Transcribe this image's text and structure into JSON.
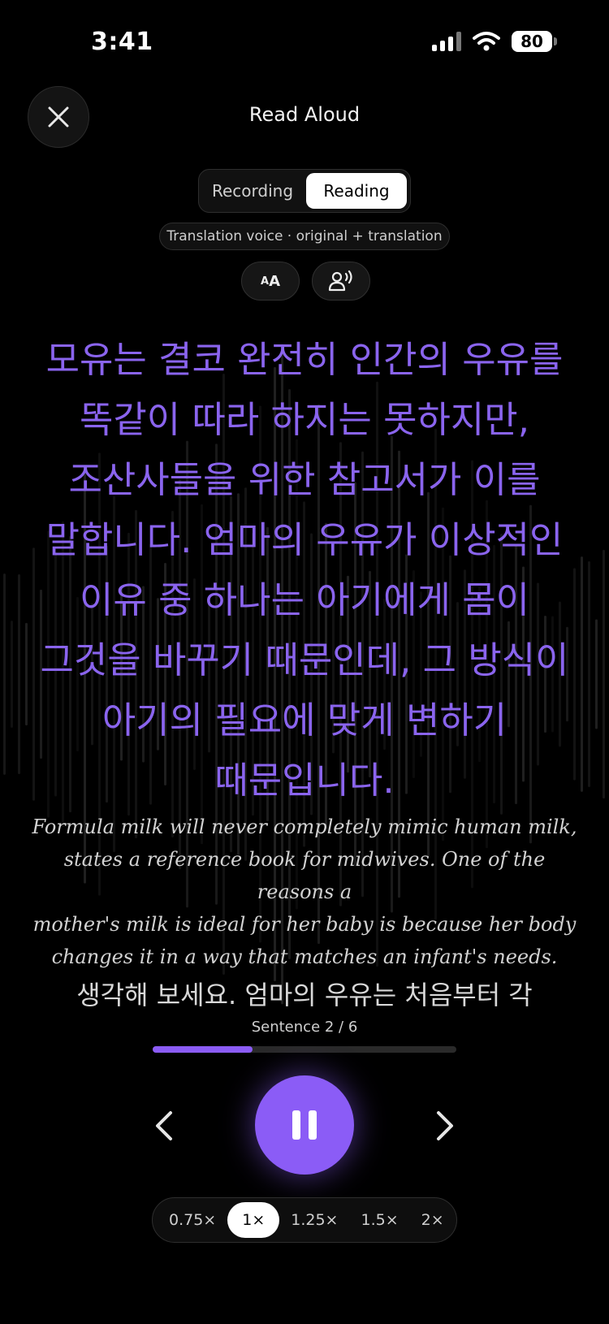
{
  "status": {
    "time": "3:41",
    "battery": "80"
  },
  "header": {
    "title": "Read Aloud"
  },
  "mode_tabs": [
    {
      "label": "Recording",
      "active": false
    },
    {
      "label": "Reading",
      "active": true
    }
  ],
  "voice_mode": "Translation voice · original + translation",
  "text_size_label": {
    "small": "A",
    "large": "A"
  },
  "current": {
    "korean_lines": [
      "모유는 결코 완전히 인간의 우유를",
      "똑같이 따라 하지는 못하지만,",
      "조산사들을 위한 참고서가 이를",
      "말합니다. 엄마의 우유가 이상적인",
      "이유 중 하나는 아기에게 몸이",
      "그것을 바꾸기 때문인데, 그 방식이",
      "아기의 필요에 맞게 변하기",
      "때문입니다."
    ],
    "english_lines": [
      "Formula milk will never completely mimic human milk,",
      "states a reference book for midwives. One of the reasons a",
      "mother's milk is ideal for her baby is because her body",
      "changes it in a way that matches an infant's needs."
    ]
  },
  "next_sentence": "생각해 보세요. 엄마의 우유는 처음부터 각",
  "sentence_counter": "Sentence 2 / 6",
  "progress": 0.33,
  "speeds": [
    {
      "label": "0.75×",
      "active": false
    },
    {
      "label": "1×",
      "active": true
    },
    {
      "label": "1.25×",
      "active": false
    },
    {
      "label": "1.5×",
      "active": false
    },
    {
      "label": "2×",
      "active": false
    }
  ],
  "colors": {
    "accent": "#8b5cf6",
    "korean_text": "#8a64ee",
    "background": "#000000"
  },
  "icons": {
    "close": "close-icon",
    "voice": "voice-speaker-icon",
    "prev": "chevron-left-icon",
    "next": "chevron-right-icon",
    "play": "pause-icon"
  }
}
